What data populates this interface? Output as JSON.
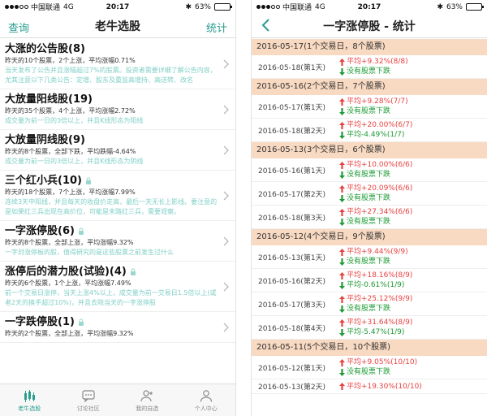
{
  "status": {
    "carrier": "中国联通",
    "network": "4G",
    "time": "20:17",
    "battery": "63%",
    "battery_fill": 0.63
  },
  "left": {
    "nav": {
      "left": "查询",
      "title": "老牛选股",
      "right": "统计"
    },
    "items": [
      {
        "title": "大涨的公告股(8)",
        "locked": false,
        "sub": "昨天的10个股票，2个上涨，平均涨幅0.71%",
        "desc": "当天发布了公告并且涨幅超过7%的股票。投资者需要详细了解公告内容，尤其注意以下几类公告：定增、股东及重监高增持、高送转、改名"
      },
      {
        "title": "大放量阳线股(19)",
        "locked": false,
        "sub": "昨天的35个股票，4个上涨，平均涨幅2.72%",
        "desc": "成交量为前一日的3倍以上，并且K线形态为阳线"
      },
      {
        "title": "大放量阴线股(9)",
        "locked": false,
        "sub": "昨天的8个股票，全部下跌，平均跌幅-4.64%",
        "desc": "成交量为前一日的3倍以上，并且K线形态为阴线"
      },
      {
        "title": "三个红小兵(10)",
        "locked": true,
        "sub": "昨天的18个股票，7个上涨，平均涨幅7.99%",
        "desc": "连续3天中阳线，并且每天的收盘价走高，最后一天无长上影线。要注意的是如果红三兵出现在高价位，可能是末路红三兵，需要观察。"
      },
      {
        "title": "一字涨停股(6)",
        "locked": true,
        "sub": "昨天的8个股票，全部上涨，平均涨幅9.32%",
        "desc": "一字封涨停板的股，值得研究的是这些股票之前发生过什么"
      },
      {
        "title": "涨停后的潜力股(试验)(4)",
        "locked": true,
        "sub": "昨天的6个股票，1个上涨，平均涨幅7.49%",
        "desc": "前一个交易日涨停，当天上涨4%以上，成交量为前一交易日1.5倍以上(或者2天的换手超过10%)，并且去除当天的一字涨停股"
      },
      {
        "title": "一字跌停股(1)",
        "locked": true,
        "sub": "昨天的2个股票，全部上涨，平均涨幅9.32%",
        "desc": ""
      }
    ],
    "tabs": [
      {
        "label": "老牛选股",
        "icon": "candlestick-icon",
        "active": true
      },
      {
        "label": "讨论社区",
        "icon": "chat-icon",
        "active": false
      },
      {
        "label": "我的自选",
        "icon": "person-add-icon",
        "active": false
      },
      {
        "label": "个人中心",
        "icon": "user-icon",
        "active": false
      }
    ]
  },
  "right": {
    "nav": {
      "title": "一字涨停股 - 统计"
    },
    "groups": [
      {
        "header": "2016-05-17(1个交易日，8个股票)",
        "rows": [
          {
            "date": "2016-05-18(第1天)",
            "values": [
              {
                "dir": "up",
                "text": "平均+9.32%(8/8)"
              },
              {
                "dir": "down",
                "text": "没有股票下跌"
              }
            ]
          }
        ]
      },
      {
        "header": "2016-05-16(2个交易日，7个股票)",
        "rows": [
          {
            "date": "2016-05-17(第1天)",
            "values": [
              {
                "dir": "up",
                "text": "平均+9.28%(7/7)"
              },
              {
                "dir": "down",
                "text": "没有股票下跌"
              }
            ]
          },
          {
            "date": "2016-05-18(第2天)",
            "values": [
              {
                "dir": "up",
                "text": "平均+20.00%(6/7)"
              },
              {
                "dir": "down",
                "text": "平均-4.49%(1/7)"
              }
            ]
          }
        ]
      },
      {
        "header": "2016-05-13(3个交易日，6个股票)",
        "rows": [
          {
            "date": "2016-05-16(第1天)",
            "values": [
              {
                "dir": "up",
                "text": "平均+10.00%(6/6)"
              },
              {
                "dir": "down",
                "text": "没有股票下跌"
              }
            ]
          },
          {
            "date": "2016-05-17(第2天)",
            "values": [
              {
                "dir": "up",
                "text": "平均+20.09%(6/6)"
              },
              {
                "dir": "down",
                "text": "没有股票下跌"
              }
            ]
          },
          {
            "date": "2016-05-18(第3天)",
            "values": [
              {
                "dir": "up",
                "text": "平均+27.34%(6/6)"
              },
              {
                "dir": "down",
                "text": "没有股票下跌"
              }
            ]
          }
        ]
      },
      {
        "header": "2016-05-12(4个交易日，9个股票)",
        "rows": [
          {
            "date": "2016-05-13(第1天)",
            "values": [
              {
                "dir": "up",
                "text": "平均+9.44%(9/9)"
              },
              {
                "dir": "down",
                "text": "没有股票下跌"
              }
            ]
          },
          {
            "date": "2016-05-16(第2天)",
            "values": [
              {
                "dir": "up",
                "text": "平均+18.16%(8/9)"
              },
              {
                "dir": "down",
                "text": "平均-0.61%(1/9)"
              }
            ]
          },
          {
            "date": "2016-05-17(第3天)",
            "values": [
              {
                "dir": "up",
                "text": "平均+25.12%(9/9)"
              },
              {
                "dir": "down",
                "text": "没有股票下跌"
              }
            ]
          },
          {
            "date": "2016-05-18(第4天)",
            "values": [
              {
                "dir": "up",
                "text": "平均+31.64%(8/9)"
              },
              {
                "dir": "down",
                "text": "平均-5.47%(1/9)"
              }
            ]
          }
        ]
      },
      {
        "header": "2016-05-11(5个交易日，10个股票)",
        "rows": [
          {
            "date": "2016-05-12(第1天)",
            "values": [
              {
                "dir": "up",
                "text": "平均+9.05%(10/10)"
              },
              {
                "dir": "down",
                "text": "没有股票下跌"
              }
            ]
          },
          {
            "date": "2016-05-13(第2天)",
            "values": [
              {
                "dir": "up",
                "text": "平均+19.30%(10/10)"
              }
            ]
          }
        ]
      }
    ]
  },
  "colors": {
    "accent": "#2a9d8f",
    "up": "#e84141",
    "down": "#1d9a35",
    "group_bg": "#f8d9c1",
    "desc": "#7fcfc6"
  }
}
